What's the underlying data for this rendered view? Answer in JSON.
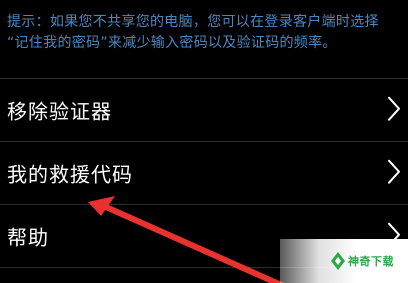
{
  "hint": {
    "line1": "提示：如果您不共享您的电脑，您可以在登录客户端时选择",
    "line2": "“记住我的密码”来减少输入密码以及验证码的频率。"
  },
  "menu": {
    "items": [
      {
        "label": "移除验证器"
      },
      {
        "label": "我的救援代码"
      },
      {
        "label": "帮助"
      }
    ]
  },
  "watermark": {
    "text": "神奇下载"
  },
  "colors": {
    "background": "#000000",
    "hint_text": "#4a87c2",
    "item_text": "#ffffff",
    "divider": "#2c2c2c",
    "annotation_arrow": "#e8322f",
    "watermark_green": "#2aa84a"
  },
  "icons": {
    "row_chevron": "chevron-right-icon",
    "annotation": "red-arrow-annotation",
    "watermark_logo": "watermark-logo-icon"
  }
}
